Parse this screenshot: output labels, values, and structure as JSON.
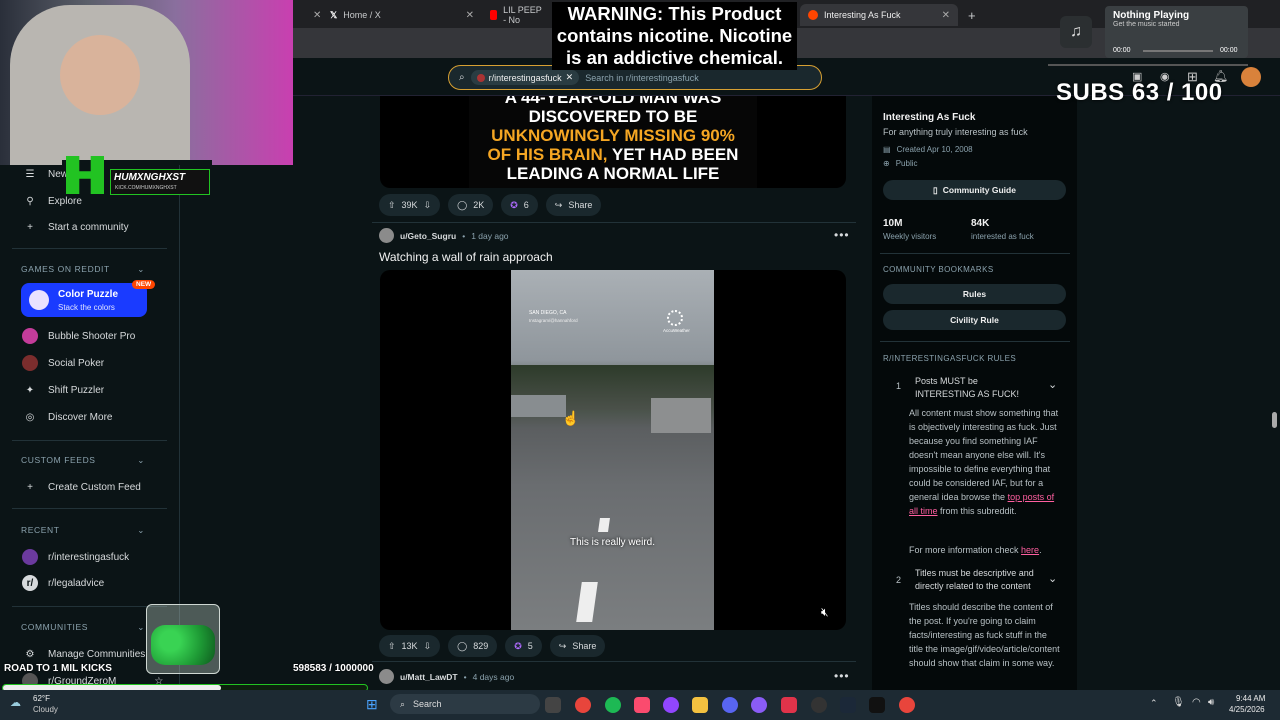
{
  "tabs": [
    {
      "title": "Home / X"
    },
    {
      "title": "LIL PEEP - No"
    },
    {
      "title": "Interesting As Fuck"
    }
  ],
  "search": {
    "chip": "r/interestingasfuck",
    "placeholder": "Search in r/interestingasfuck"
  },
  "sidebar": {
    "top_items": [
      "New",
      "Explore",
      "Start a community"
    ],
    "games_header": "GAMES ON REDDIT",
    "featured_game": {
      "title": "Color Puzzle",
      "subtitle": "Stack the colors",
      "badge": "NEW"
    },
    "games": [
      "Bubble Shooter Pro",
      "Social Poker",
      "Shift Puzzler",
      "Discover More"
    ],
    "custom_feeds_header": "CUSTOM FEEDS",
    "create_feed": "Create Custom Feed",
    "recent_header": "RECENT",
    "recent": [
      "r/interestingasfuck",
      "r/legaladvice"
    ],
    "communities_header": "COMMUNITIES",
    "manage_communities": "Manage Communities",
    "partial_community": "r/GroundZeroM"
  },
  "posts": [
    {
      "image_lines": [
        "A 44-YEAR-OLD MAN WAS",
        "DISCOVERED TO BE",
        "UNKNOWINGLY MISSING 90%",
        "OF HIS BRAIN,",
        " YET HAD BEEN",
        "LEADING A NORMAL LIFE"
      ],
      "votes": "39K",
      "comments": "2K",
      "awards": "6",
      "share": "Share"
    },
    {
      "user": "u/Geto_Sugru",
      "time": "1 day ago",
      "title": "Watching a wall of rain approach",
      "video_location": "SAN DIEGO, CA",
      "video_handle": "Instagram/@hannahford",
      "video_watermark": "AccuWeather",
      "caption": "This is really weird.",
      "votes": "13K",
      "comments": "829",
      "awards": "5",
      "share": "Share"
    },
    {
      "user": "u/Matt_LawDT",
      "time": "4 days ago"
    }
  ],
  "community": {
    "name": "Interesting As Fuck",
    "description": "For anything truly interesting as fuck",
    "created": "Created Apr 10, 2008",
    "visibility": "Public",
    "guide_button": "Community Guide",
    "stats": [
      {
        "value": "10M",
        "label": "Weekly visitors"
      },
      {
        "value": "84K",
        "label": "interested as fuck"
      }
    ],
    "bookmarks_header": "COMMUNITY BOOKMARKS",
    "bookmarks": [
      "Rules",
      "Civility Rule"
    ],
    "rules_header": "R/INTERESTINGASFUCK RULES",
    "rules": [
      {
        "num": "1",
        "title": "Posts MUST be INTERESTING AS FUCK!",
        "body_a": "All content must show something that is objectively interesting as fuck. Just because you find something IAF doesn't mean anyone else will. It's impossible to define everything that could be considered IAF, but for a general idea browse the ",
        "link": "top posts of all time",
        "body_b": " from this subreddit.",
        "more_a": "For more information check ",
        "more_link": "here",
        "more_b": "."
      },
      {
        "num": "2",
        "title": "Titles must be descriptive and directly related to the content",
        "body": "Titles should describe the content of the post. If you're going to claim facts/interesting as fuck stuff in the title the image/gif/video/article/content should show that claim in some way."
      }
    ]
  },
  "overlays": {
    "warning": "WARNING: This Product contains nicotine. Nicotine is an addictive chemical.",
    "subs": "SUBS 63 / 100",
    "now_playing_title": "Nothing Playing",
    "now_playing_sub": "Get the music started",
    "time_start": "00:00",
    "time_end": "00:00",
    "streamer_name": "HUMXNGHXST",
    "streamer_url": "KICK.COM/HUMXNGHXST",
    "road_label": "ROAD TO 1 MIL KICKS",
    "road_count": "598583 / 1000000",
    "road_progress": 0.598583
  },
  "taskbar": {
    "weather_temp": "62°F",
    "weather_cond": "Cloudy",
    "search": "Search",
    "time": "9:44 AM",
    "date": "4/25/2026"
  },
  "colors": {
    "accent_search": "#d7a032",
    "link": "#ff5fa0",
    "featured_game": "#1a3bff",
    "bg": "#0b1416"
  }
}
